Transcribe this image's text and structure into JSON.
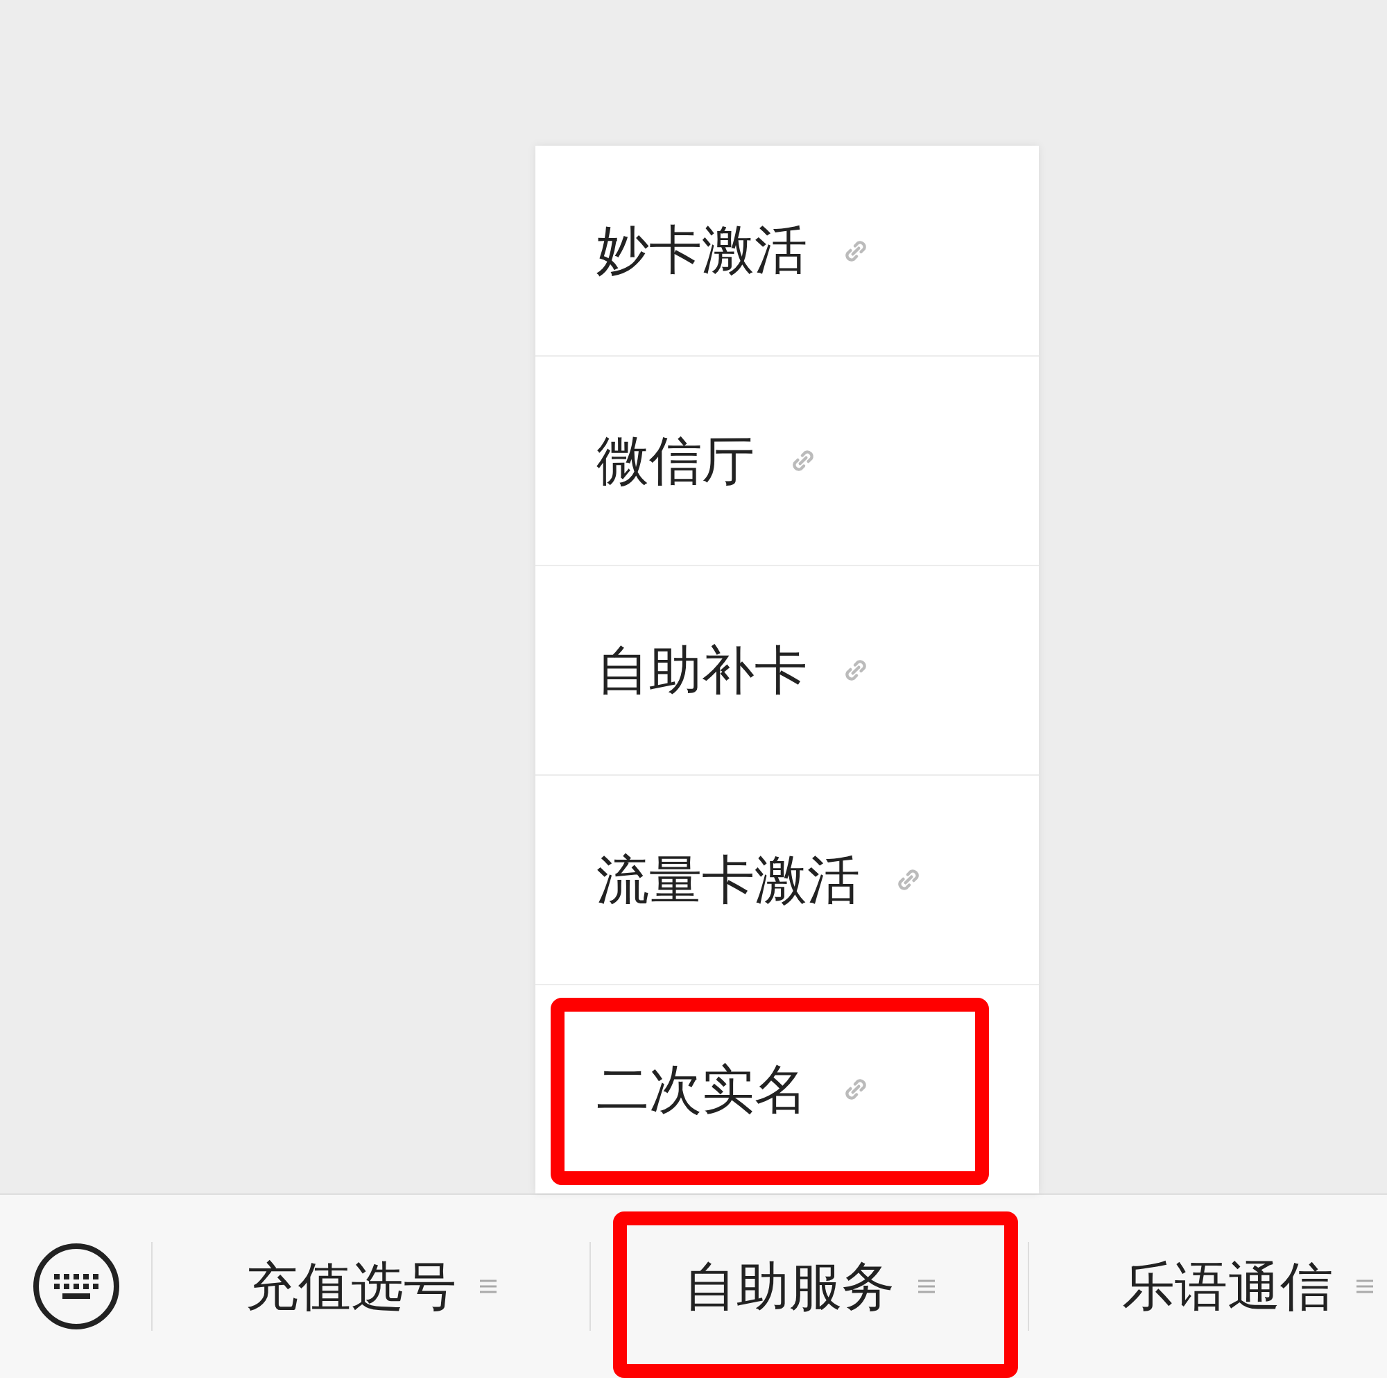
{
  "submenu": {
    "items": [
      {
        "label": "妙卡激活",
        "highlighted": false
      },
      {
        "label": "微信厅",
        "highlighted": false
      },
      {
        "label": "自助补卡",
        "highlighted": false
      },
      {
        "label": "流量卡激活",
        "highlighted": false
      },
      {
        "label": "二次实名",
        "highlighted": true
      }
    ]
  },
  "menu_bar": {
    "tabs": [
      {
        "label": "充值选号",
        "highlighted": false
      },
      {
        "label": "自助服务",
        "highlighted": true
      },
      {
        "label": "乐语通信",
        "highlighted": false
      }
    ]
  }
}
